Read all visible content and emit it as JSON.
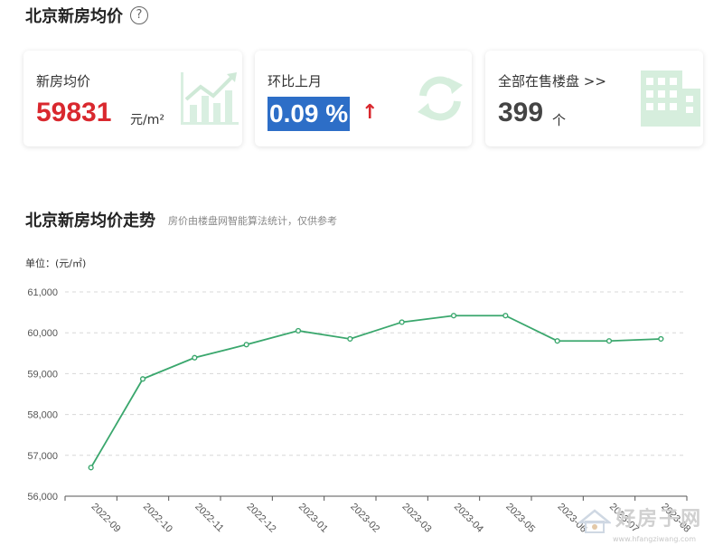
{
  "header": {
    "title": "北京新房均价",
    "help_symbol": "?"
  },
  "cards": {
    "avg_price": {
      "label": "新房均价",
      "value": "59831",
      "unit": "元/m²",
      "icon": "rising-chart-icon"
    },
    "mom": {
      "label": "环比上月",
      "value": "0.09 %",
      "arrow": "↑",
      "icon": "refresh-cycle-icon"
    },
    "listings": {
      "label": "全部在售楼盘 >>",
      "value": "399",
      "unit": "个",
      "icon": "building-icon"
    }
  },
  "trend": {
    "title": "北京新房均价走势",
    "subtitle": "房价由楼盘网智能算法统计，仅供参考",
    "unit_label": "单位：(元/㎡)"
  },
  "chart_data": {
    "type": "line",
    "x": [
      "2022-09",
      "2022-10",
      "2022-11",
      "2022-12",
      "2023-01",
      "2023-02",
      "2023-03",
      "2023-04",
      "2023-05",
      "2023-06",
      "2023-07",
      "2023-08"
    ],
    "series": [
      {
        "values": [
          56700,
          58870,
          59390,
          59710,
          60050,
          59850,
          60260,
          60420,
          60420,
          59800,
          59800,
          59850
        ]
      }
    ],
    "ylim": [
      56000,
      61000
    ],
    "yticks": [
      56000,
      57000,
      58000,
      59000,
      60000,
      61000
    ],
    "ytick_labels": [
      "56,000",
      "57,000",
      "58,000",
      "59,000",
      "60,000",
      "61,000"
    ],
    "grid": true,
    "line_color": "#3aa76d"
  },
  "watermark": {
    "text": "好房子网",
    "url": "www.hfangziwang.com"
  }
}
